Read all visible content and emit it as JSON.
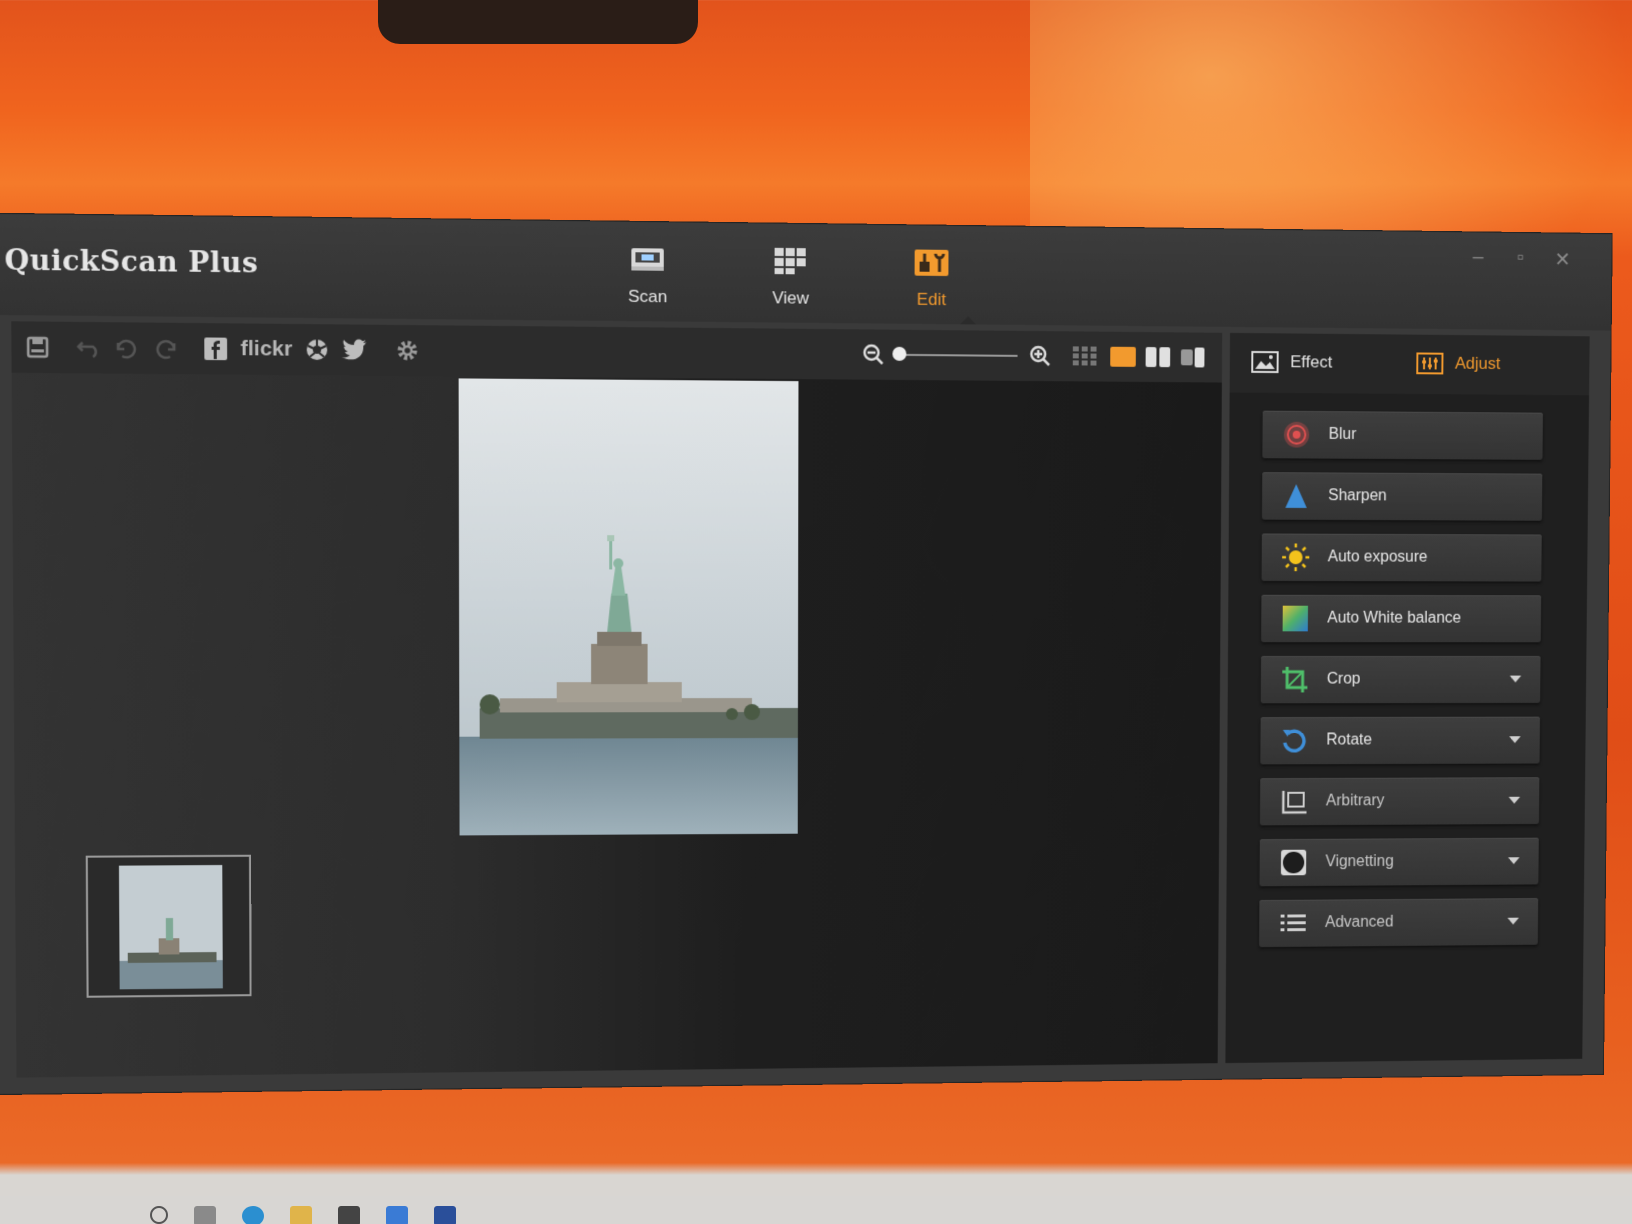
{
  "app": {
    "title": "QuickScan Plus"
  },
  "mode_tabs": [
    {
      "label": "Scan",
      "icon": "scanner-icon",
      "active": false
    },
    {
      "label": "View",
      "icon": "grid-view-icon",
      "active": false
    },
    {
      "label": "Edit",
      "icon": "edit-tools-icon",
      "active": true
    }
  ],
  "window_controls": {
    "minimize": "–",
    "maximize": "▫",
    "close": "✕"
  },
  "toolbar": {
    "share_flickr_label": "flickr",
    "icons": [
      "save-icon",
      "undo-all-icon",
      "undo-icon",
      "redo-icon",
      "facebook-icon",
      "flickr-logo",
      "picasa-icon",
      "twitter-icon",
      "settings-icon",
      "zoom-out-icon",
      "zoom-in-icon",
      "thumbnail-grid-icon",
      "single-view-icon",
      "dual-view-icon",
      "compare-view-icon"
    ],
    "zoom_level": 0.0
  },
  "panel_tabs": [
    {
      "label": "Effect",
      "icon": "effect-image-icon",
      "active": false
    },
    {
      "label": "Adjust",
      "icon": "adjust-sliders-icon",
      "active": true
    }
  ],
  "adjust_tools": [
    {
      "label": "Blur",
      "icon": "blur-icon",
      "has_dropdown": false
    },
    {
      "label": "Sharpen",
      "icon": "sharpen-icon",
      "has_dropdown": false
    },
    {
      "label": "Auto exposure",
      "icon": "auto-exposure-icon",
      "has_dropdown": false
    },
    {
      "label": "Auto White balance",
      "icon": "white-balance-icon",
      "has_dropdown": false
    },
    {
      "label": "Crop",
      "icon": "crop-icon",
      "has_dropdown": true
    },
    {
      "label": "Rotate",
      "icon": "rotate-icon",
      "has_dropdown": true
    },
    {
      "label": "Arbitrary",
      "icon": "arbitrary-icon",
      "has_dropdown": true
    },
    {
      "label": "Vignetting",
      "icon": "vignetting-icon",
      "has_dropdown": true
    },
    {
      "label": "Advanced",
      "icon": "advanced-list-icon",
      "has_dropdown": true
    }
  ],
  "colors": {
    "accent": "#f29a2e",
    "window_bg": "#3a3a3a",
    "panel_bg": "#1f1f1f",
    "button_bg": "#3a3a3a",
    "backdrop": "#e8581c"
  }
}
